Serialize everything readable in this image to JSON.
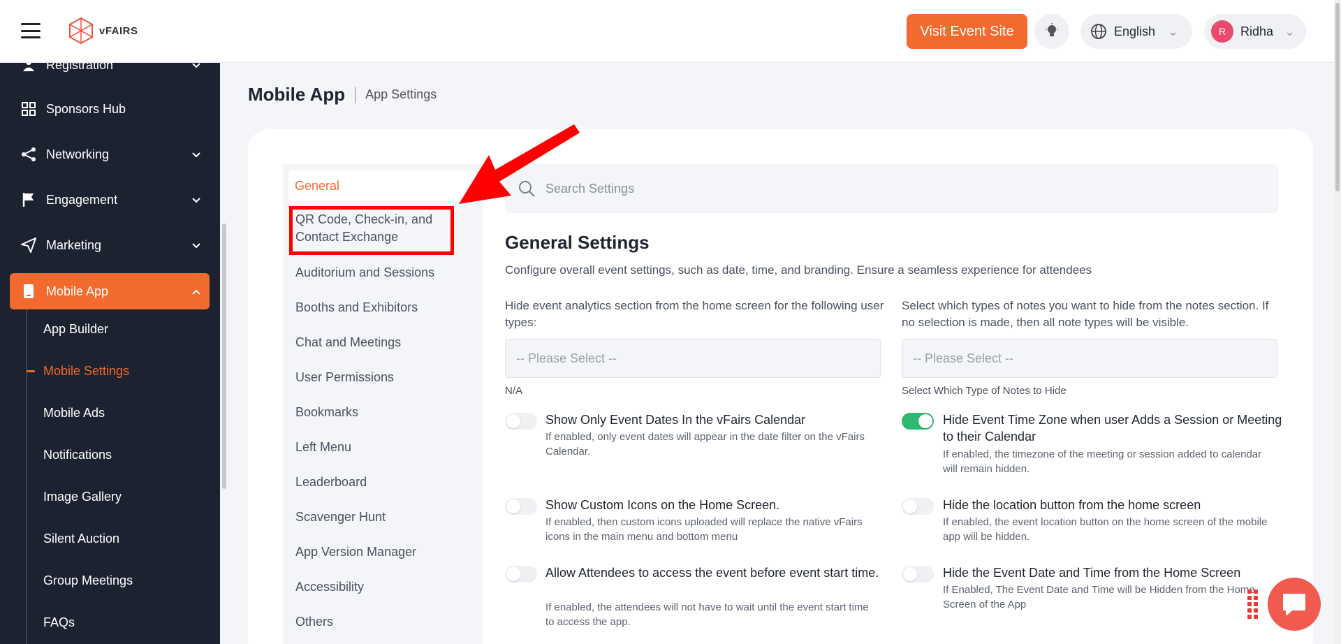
{
  "header": {
    "logo_text": "vFAIRS",
    "visit_label": "Visit Event Site",
    "language": "English",
    "user_initial": "R",
    "user_name": "Ridha"
  },
  "sidebar": {
    "items": [
      {
        "label": "Registration",
        "icon": "user-icon"
      },
      {
        "label": "Sponsors Hub",
        "icon": "grid-icon"
      },
      {
        "label": "Networking",
        "icon": "share-icon"
      },
      {
        "label": "Engagement",
        "icon": "flag-icon"
      },
      {
        "label": "Marketing",
        "icon": "send-icon"
      },
      {
        "label": "Mobile App",
        "icon": "mobile-icon"
      }
    ],
    "subitems": [
      {
        "label": "App Builder"
      },
      {
        "label": "Mobile Settings"
      },
      {
        "label": "Mobile Ads"
      },
      {
        "label": "Notifications"
      },
      {
        "label": "Image Gallery"
      },
      {
        "label": "Silent Auction"
      },
      {
        "label": "Group Meetings"
      },
      {
        "label": "FAQs"
      }
    ]
  },
  "breadcrumb": {
    "main": "Mobile App",
    "sub": "App Settings"
  },
  "settings_nav": {
    "items": [
      {
        "label": "General"
      },
      {
        "label": "QR Code, Check-in, and Contact Exchange"
      },
      {
        "label": "Auditorium and Sessions"
      },
      {
        "label": "Booths and Exhibitors"
      },
      {
        "label": "Chat and Meetings"
      },
      {
        "label": "User Permissions"
      },
      {
        "label": "Bookmarks"
      },
      {
        "label": "Left Menu"
      },
      {
        "label": "Leaderboard"
      },
      {
        "label": "Scavenger Hunt"
      },
      {
        "label": "App Version Manager"
      },
      {
        "label": "Accessibility"
      },
      {
        "label": "Others"
      }
    ]
  },
  "search": {
    "placeholder": "Search Settings"
  },
  "general": {
    "title": "General Settings",
    "description": "Configure overall event settings, such as date, time, and branding. Ensure a seamless experience for attendees",
    "left_field": {
      "label": "Hide event analytics section from the home screen for the following user types:",
      "placeholder": "-- Please Select --",
      "helper": "N/A"
    },
    "right_field": {
      "label": "Select which types of notes you want to hide from the notes section. If no selection is made, then all note types will be visible.",
      "placeholder": "-- Please Select --",
      "helper": "Select Which Type of Notes to Hide"
    },
    "options": [
      {
        "title": "Show Only Event Dates In the vFairs Calendar",
        "desc": "If enabled, only event dates will appear in the date filter on the vFairs Calendar.",
        "on": false
      },
      {
        "title": "Hide Event Time Zone when user Adds a Session or Meeting to their Calendar",
        "desc": "If enabled, the timezone of the meeting or session added to calendar will remain hidden.",
        "on": true
      },
      {
        "title": "Show Custom Icons on the Home Screen.",
        "desc": "If enabled, then custom icons uploaded will replace the native vFairs icons in the main menu and bottom menu",
        "on": false
      },
      {
        "title": "Hide the location button from the home screen",
        "desc": "If enabled, the event location button on the home screen of the mobile app will be hidden.",
        "on": false
      },
      {
        "title": "Allow Attendees to access the event before event start time.",
        "desc": "If enabled, the attendees will not have to wait until the event start time to access the app.",
        "on": false
      },
      {
        "title": "Hide the Event Date and Time from the Home Screen",
        "desc": "If Enabled, The Event Date and Time will be Hidden from the Home Screen of the App",
        "on": false
      }
    ]
  },
  "colors": {
    "accent": "#f26a2e",
    "sidebar_bg": "#1c2230",
    "toggle_on": "#2eb872",
    "annotation": "#ff0000"
  }
}
